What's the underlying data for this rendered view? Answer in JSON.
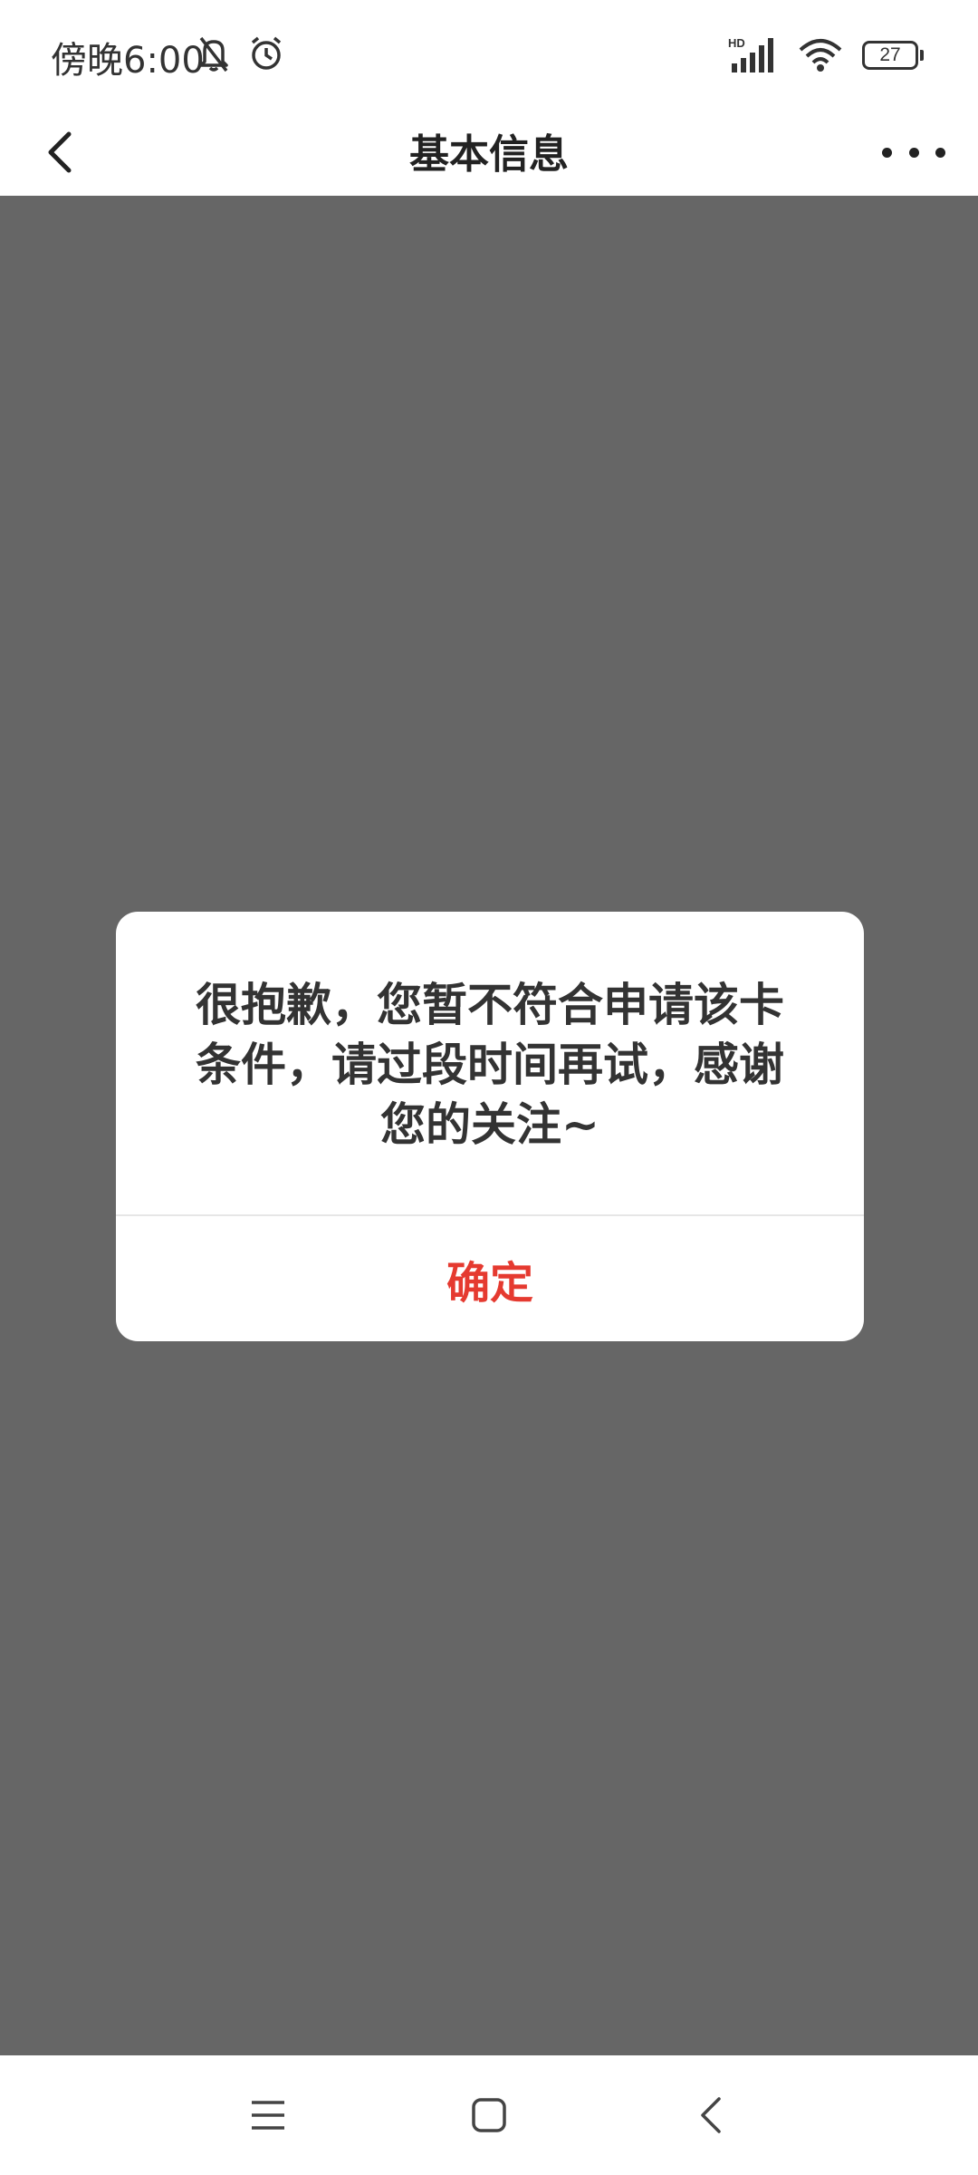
{
  "status_bar": {
    "time": "傍晚6:00",
    "network_label": "HD",
    "battery_level": "27",
    "icons": [
      "mute-bell-icon",
      "alarm-icon",
      "signal-icon",
      "wifi-icon",
      "battery-icon"
    ]
  },
  "nav_bar": {
    "title": "基本信息",
    "back_icon": "chevron-left-icon",
    "more_icon": "more-horizontal-icon"
  },
  "dialog": {
    "message": "很抱歉，您暂不符合申请该卡条件，请过段时间再试，感谢您的关注~",
    "confirm_label": "确定"
  },
  "bottom_nav": {
    "icons": [
      "menu-icon",
      "home-icon",
      "back-icon"
    ]
  },
  "colors": {
    "overlay": "#666666",
    "confirm_accent": "#e53a30",
    "text_primary": "#333333"
  }
}
